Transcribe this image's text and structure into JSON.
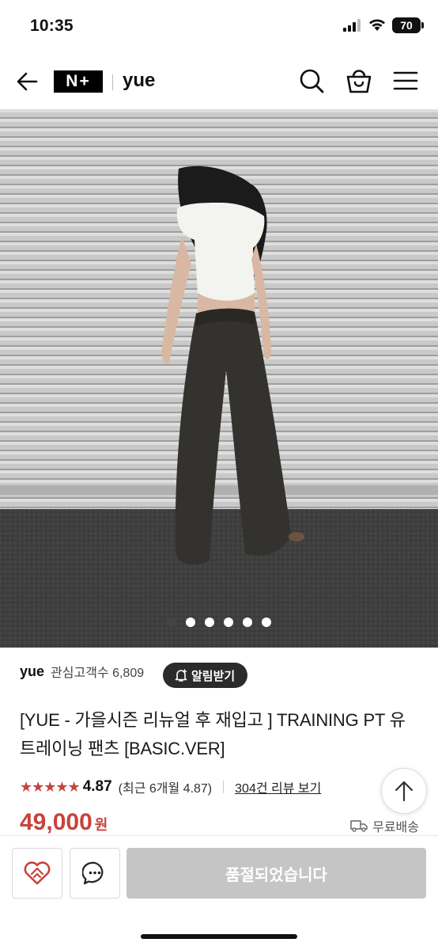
{
  "status_bar": {
    "time": "10:35",
    "battery": "70"
  },
  "header": {
    "logo": "N+",
    "brand": "yue"
  },
  "carousel": {
    "total": 6,
    "active_index": 0
  },
  "product": {
    "brand": "yue",
    "followers_label": "관심고객수 6,809",
    "alarm_label": "알림받기",
    "title": "[YUE - 가을시즌 리뉴얼 후 재입고 ] TRAINING PT 유 트레이닝 팬츠 [BASIC.VER]",
    "stars": "★★★★★",
    "rating": "4.87",
    "recent_rating": "(최근 6개월 4.87)",
    "review_link": "304건 리뷰 보기",
    "price_num": "49,000",
    "price_unit": "원",
    "shipping": "무료배송"
  },
  "bottom_bar": {
    "soldout_label": "품절되었습니다"
  },
  "colors": {
    "accent": "#c8433b",
    "soldout": "#c5c5c5"
  }
}
